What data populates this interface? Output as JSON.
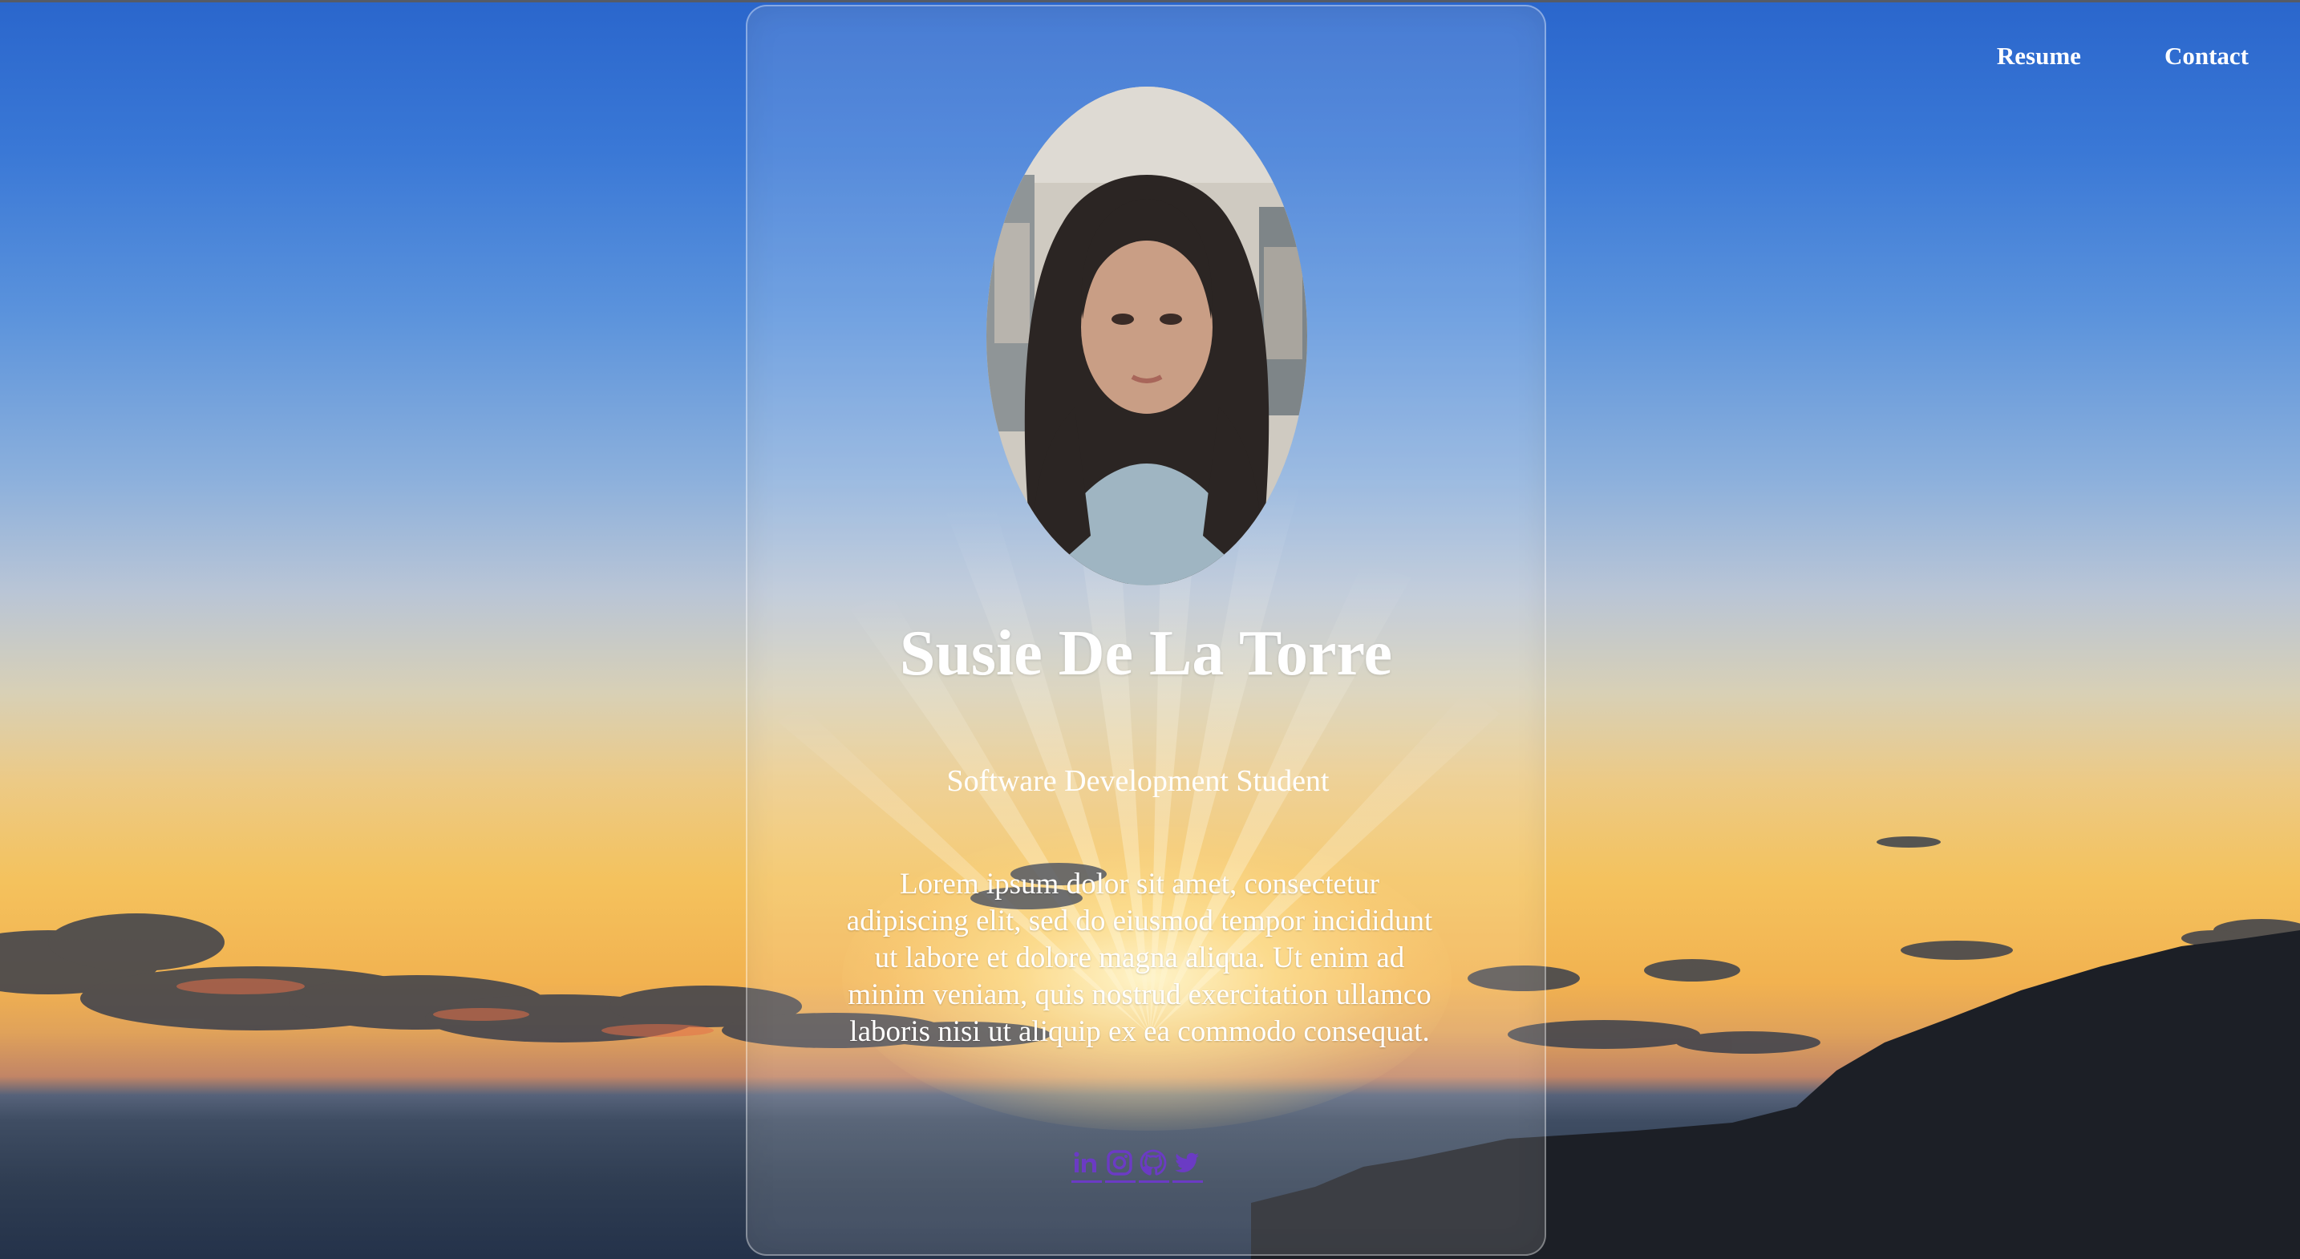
{
  "nav": {
    "resume_label": "Resume",
    "contact_label": "Contact"
  },
  "profile": {
    "name": "Susie De La Torre",
    "subtitle": "Software Development Student",
    "bio": "Lorem ipsum dolor sit amet, consectetur adipiscing elit, sed do eiusmod tempor incididunt ut labore et dolore magna aliqua. Ut enim ad minim veniam, quis nostrud exercitation ullamco laboris nisi ut aliquip ex ea commodo consequat."
  },
  "socials": [
    {
      "icon": "linkedin-icon"
    },
    {
      "icon": "instagram-icon"
    },
    {
      "icon": "github-icon"
    },
    {
      "icon": "twitter-icon"
    }
  ],
  "colors": {
    "link_accent": "#6b3bc4",
    "text": "#ffffff",
    "sky_top": "#2a66cc",
    "horizon": "#f4c25d",
    "ocean": "#2f3d52"
  }
}
